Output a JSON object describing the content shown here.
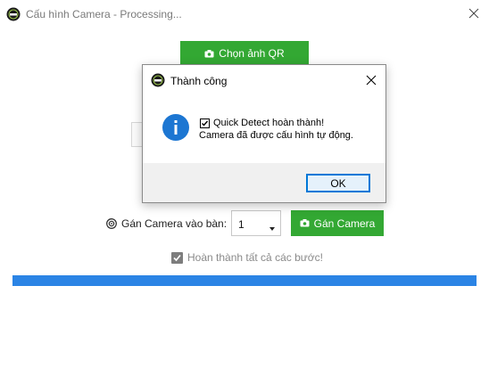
{
  "window": {
    "title": "Cấu hình Camera - Processing..."
  },
  "main": {
    "qr_button_label": "Chọn ảnh QR",
    "assign_label": "Gán Camera vào bàn:",
    "table_select_value": "1",
    "assign_button_label": "Gán Camera",
    "completed_checkbox_label": "Hoàn thành tất cả các bước!",
    "completed_checked": true,
    "progress_fraction": 1.0
  },
  "dialog": {
    "title": "Thành công",
    "message_line1": "Quick Detect hoàn thành!",
    "message_line2": "Camera đã được cấu hình tự động.",
    "ok_label": "OK",
    "icon": "info-icon"
  },
  "colors": {
    "accent_green": "#33a833",
    "progress_blue": "#2b84e5",
    "info_blue": "#1c76d2",
    "ok_border": "#0078d7"
  }
}
